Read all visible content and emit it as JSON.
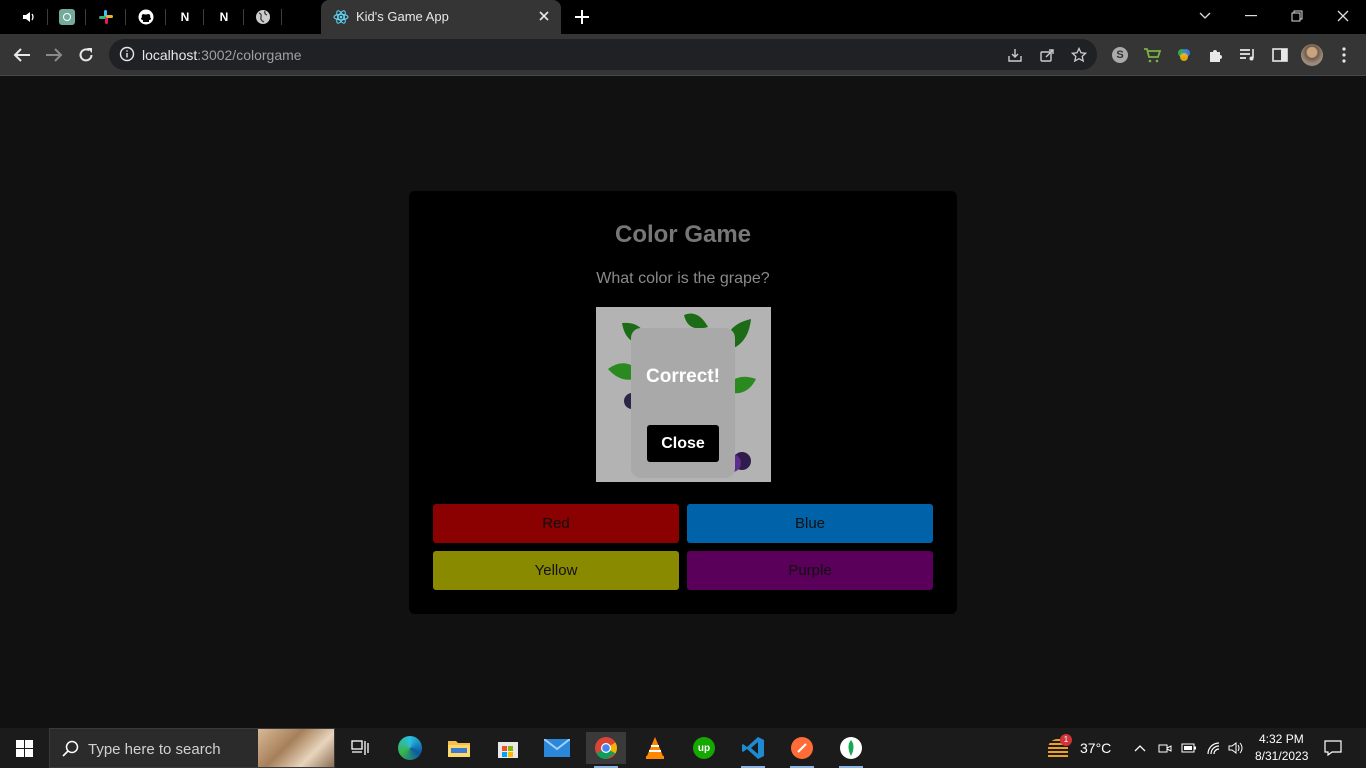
{
  "browser": {
    "active_tab_title": "Kid's Game App",
    "url_host": "localhost",
    "url_path": ":3002/colorgame",
    "pinned_tabs": [
      "audio-playing-tab",
      "chatgpt-tab",
      "slack-tab",
      "github-tab",
      "notion-tab",
      "notion-tab-2",
      "web-tab"
    ]
  },
  "game": {
    "title": "Color Game",
    "question": "What color is the grape?",
    "image_subject": "grape",
    "popup_message": "Correct!",
    "popup_close_label": "Close",
    "choices": [
      {
        "label": "Red",
        "color": "#8b0000"
      },
      {
        "label": "Blue",
        "color": "#0062a8"
      },
      {
        "label": "Yellow",
        "color": "#8a8a00"
      },
      {
        "label": "Purple",
        "color": "#5a005a"
      }
    ]
  },
  "taskbar": {
    "search_placeholder": "Type here to search",
    "temperature": "37°C",
    "weather_badge": "1",
    "time": "4:32 PM",
    "date": "8/31/2023",
    "apps": [
      "task-view",
      "edge",
      "file-explorer",
      "microsoft-store",
      "mail",
      "chrome",
      "vlc",
      "upwork",
      "vscode",
      "postman",
      "mongodb-compass"
    ]
  },
  "colors": {
    "page_bg": "#111111",
    "card_bg": "#000000",
    "image_bg": "#b3b3b3",
    "popup_bg": "#a9a9a9"
  }
}
